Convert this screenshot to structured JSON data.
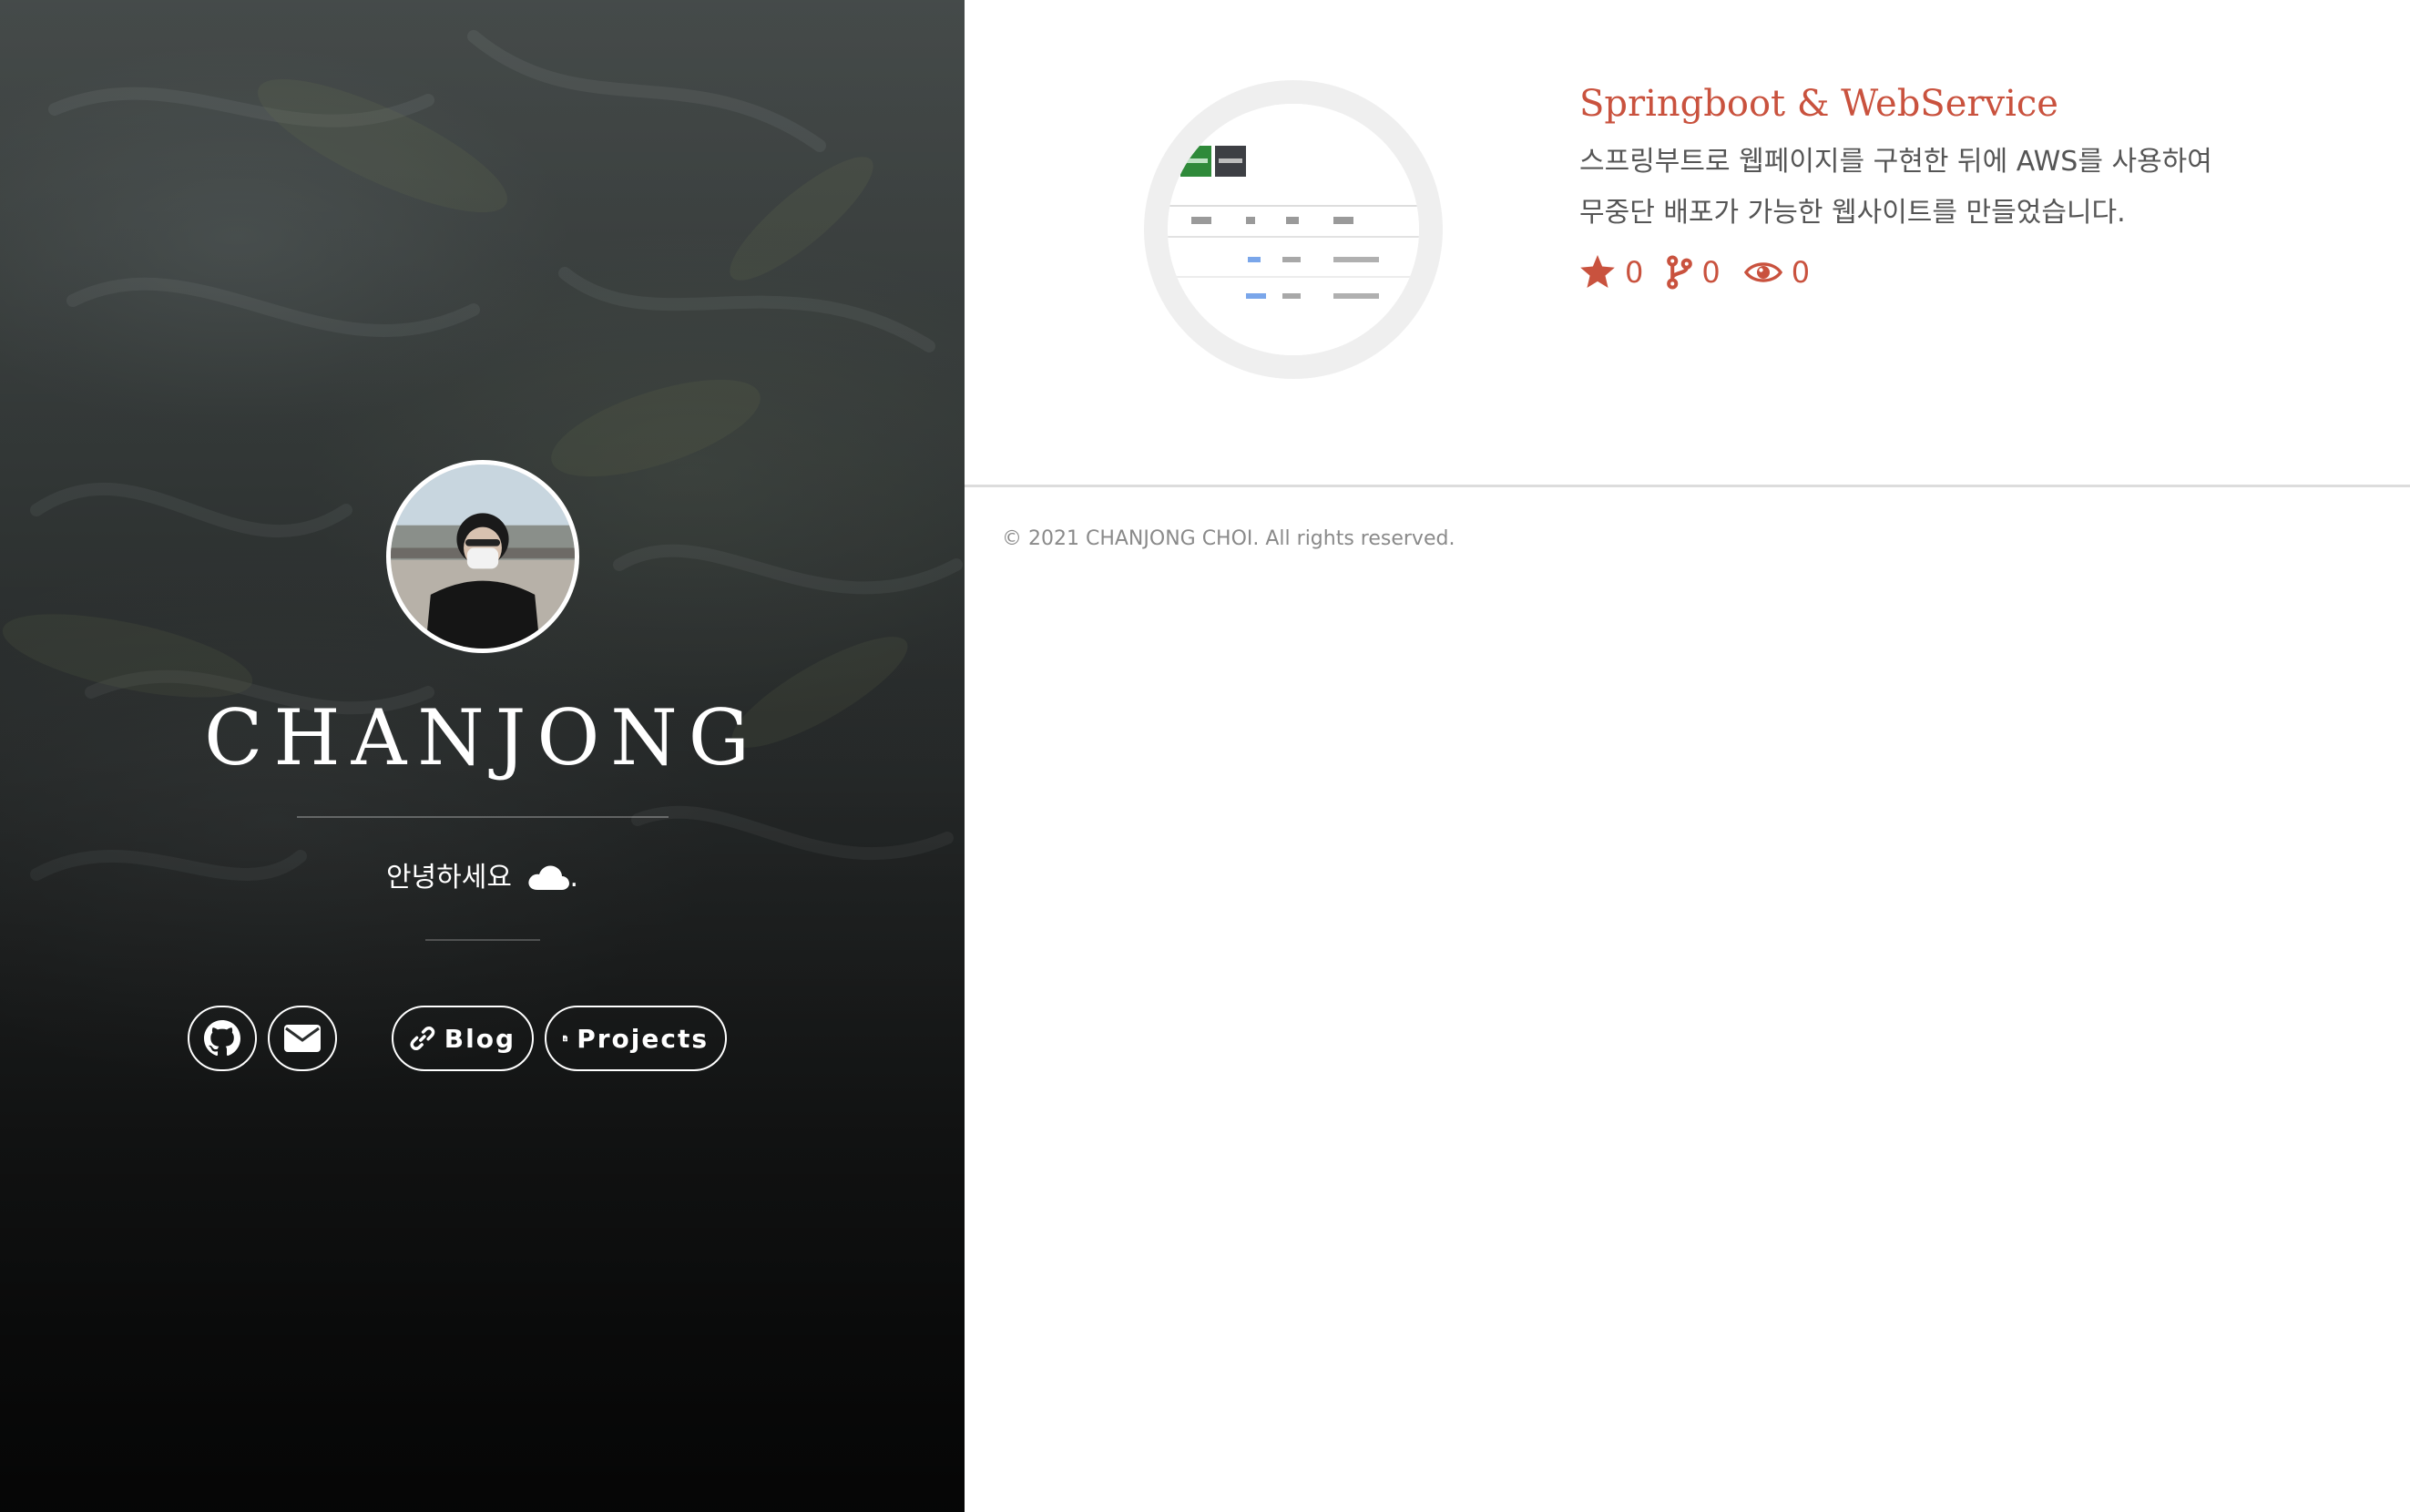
{
  "profile": {
    "name": "CHANJONG",
    "greeting": "안녕하세요",
    "greeting_suffix": "."
  },
  "links": {
    "blog_label": "Blog",
    "projects_label": "Projects"
  },
  "project": {
    "title": "Springboot & WebService",
    "description_line1": "스프링부트로 웹페이지를 구현한 뒤에 AWS를 사용하여",
    "description_line2": "무중단 배포가 가능한 웹사이트를 만들었습니다.",
    "stars": "0",
    "forks": "0",
    "watchers": "0"
  },
  "footer": {
    "copyright": "© 2021 CHANJONG CHOI. All rights reserved."
  },
  "colors": {
    "accent": "#c9523e",
    "hero_text": "#ffffff",
    "body_text": "#555555"
  },
  "icons": {
    "github": "github-icon",
    "mail": "envelope-icon",
    "blog": "link-icon",
    "projects": "code-file-icon",
    "greeting": "cloud-icon",
    "stars": "star-icon",
    "forks": "fork-icon",
    "watchers": "eye-icon"
  }
}
